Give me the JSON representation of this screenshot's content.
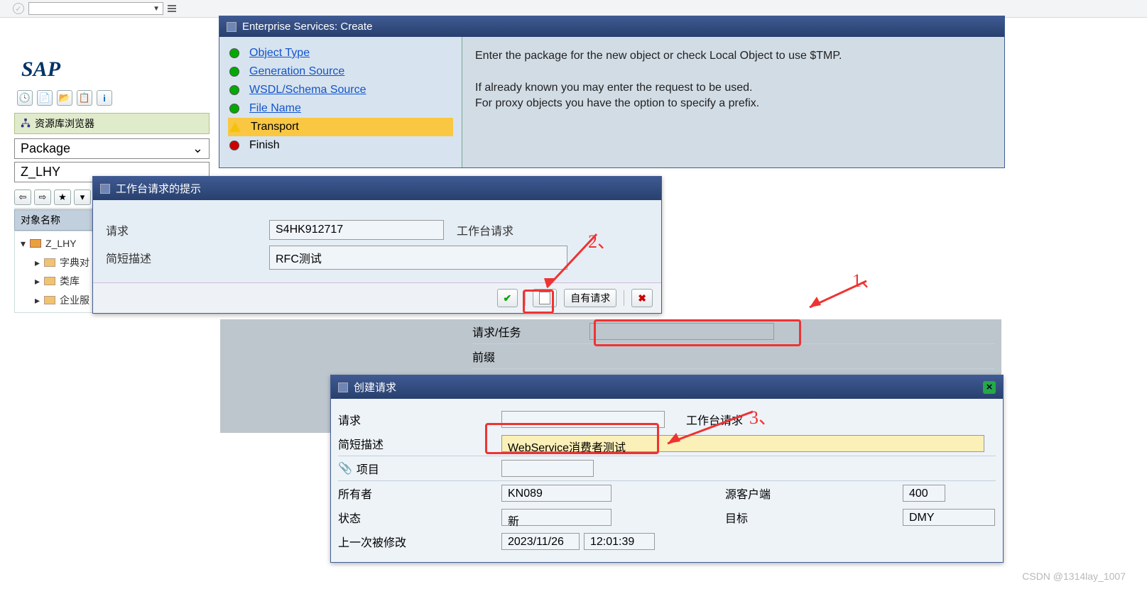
{
  "topbar": {
    "tick": "✓"
  },
  "sap": {
    "logo": "SAP",
    "nav_header": "资源库浏览器",
    "package_dropdown": "Package",
    "package_value": "Z_LHY",
    "col_header": "对象名称",
    "tree": {
      "root": "Z_LHY",
      "children": [
        "字典对",
        "类库",
        "企业服"
      ]
    }
  },
  "eswin": {
    "title": "Enterprise Services: Create",
    "steps": [
      {
        "label": "Object Type",
        "led": "green",
        "link": true
      },
      {
        "label": "Generation Source",
        "led": "green",
        "link": true
      },
      {
        "label": "WSDL/Schema Source",
        "led": "green",
        "link": true
      },
      {
        "label": "File Name",
        "led": "green",
        "link": true
      },
      {
        "label": "Transport",
        "led": "yellow",
        "link": false,
        "active": true
      },
      {
        "label": "Finish",
        "led": "red",
        "link": false
      }
    ],
    "help_line1": "Enter the package for the new object or check Local Object to use $TMP.",
    "help_line2": "If already known you may enter the request to be used.",
    "help_line3": "For proxy objects you have the option to specify a prefix."
  },
  "wbwin": {
    "title": "工作台请求的提示",
    "request_label": "请求",
    "request_val": "S4HK912717",
    "request_type": "工作台请求",
    "short_label": "简短描述",
    "short_val": "RFC测试",
    "own_requests": "自有请求"
  },
  "reqtask": {
    "request_task": "请求/任务",
    "prefix": "前缀"
  },
  "crwin": {
    "title": "创建请求",
    "request_label": "请求",
    "request_type": "工作台请求",
    "short_label": "简短描述",
    "short_val": "WebService消费者测试",
    "project_label": "项目",
    "owner_label": "所有者",
    "owner_val": "KN089",
    "source_client_label": "源客户端",
    "source_client_val": "400",
    "status_label": "状态",
    "status_val": "新",
    "target_label": "目标",
    "target_val": "DMY",
    "modified_label": "上一次被修改",
    "modified_date": "2023/11/26",
    "modified_time": "12:01:39"
  },
  "annotations": {
    "n1": "1、",
    "n2": "2、",
    "n3": "3、"
  },
  "footer": {
    "watermark": "CSDN @1314lay_1007"
  }
}
